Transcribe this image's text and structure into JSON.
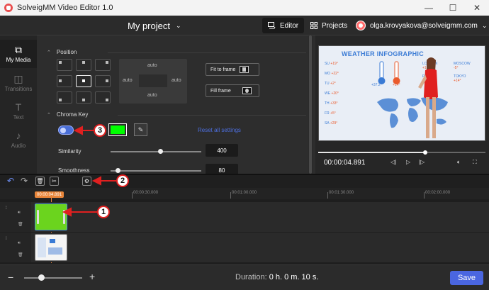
{
  "window": {
    "title": "SolveigMM Video Editor 1.0",
    "minimize": "—",
    "maximize": "☐",
    "close": "✕"
  },
  "header": {
    "project": "My project",
    "editor_label": "Editor",
    "projects_label": "Projects",
    "user_email": "olga.krovyakova@solveigmm.com"
  },
  "sidebar": {
    "items": [
      {
        "label": "My Media"
      },
      {
        "label": "Transitions"
      },
      {
        "label": "Text"
      },
      {
        "label": "Audio"
      }
    ]
  },
  "panel": {
    "position_title": "Position",
    "margin_labels": {
      "top": "auto",
      "left": "auto",
      "right": "auto",
      "bottom": "auto"
    },
    "fit_to_frame": "Fit to frame",
    "fill_frame": "Fill frame",
    "chroma_title": "Chroma Key",
    "chroma_enabled": true,
    "chroma_color": "#00ff00",
    "reset_label": "Reset all settings",
    "similarity_label": "Similarity",
    "similarity_value": "400",
    "similarity_level": 0.55,
    "smoothness_label": "Smoothness",
    "smoothness_value": "80",
    "smoothness_level": 0.08
  },
  "preview": {
    "infographic_title": "WEATHER INFOGRAPHIC",
    "cities_left": [
      {
        "name": "SU",
        "temp": "+19°"
      },
      {
        "name": "MO",
        "temp": "+22°"
      },
      {
        "name": "TU",
        "temp": "+2°"
      },
      {
        "name": "WE",
        "temp": "+20°"
      },
      {
        "name": "TH",
        "temp": "+33°"
      },
      {
        "name": "FR",
        "temp": "+5°"
      },
      {
        "name": "SA",
        "temp": "+29°"
      }
    ],
    "cities_right": [
      {
        "name": "LONDON",
        "temp": "+10°"
      },
      {
        "name": "MOSCOW",
        "temp": "-5°"
      },
      {
        "name": "PARIS",
        "temp": "+8°"
      },
      {
        "name": "TOKYO",
        "temp": "+14°"
      }
    ],
    "thermo_left": "+37.2°",
    "thermo_right": "+14°",
    "timecode": "00:00:04.891",
    "progress": 0.64
  },
  "timeline": {
    "playhead_time": "00:00:04.891",
    "ruler_labels": [
      "00:00:30.000",
      "00:01:00.000",
      "00:01:30.000",
      "00:02:00.000"
    ]
  },
  "footer": {
    "duration_label": "Duration:",
    "duration_value": "0 h. 0 m. 10 s.",
    "save_label": "Save",
    "zoom_level": 0.3
  },
  "annotations": {
    "callout_1": "1",
    "callout_2": "2",
    "callout_3": "3"
  },
  "colors": {
    "accent": "#4a66e0",
    "playhead": "#e8853a",
    "annotation": "#e02020"
  }
}
